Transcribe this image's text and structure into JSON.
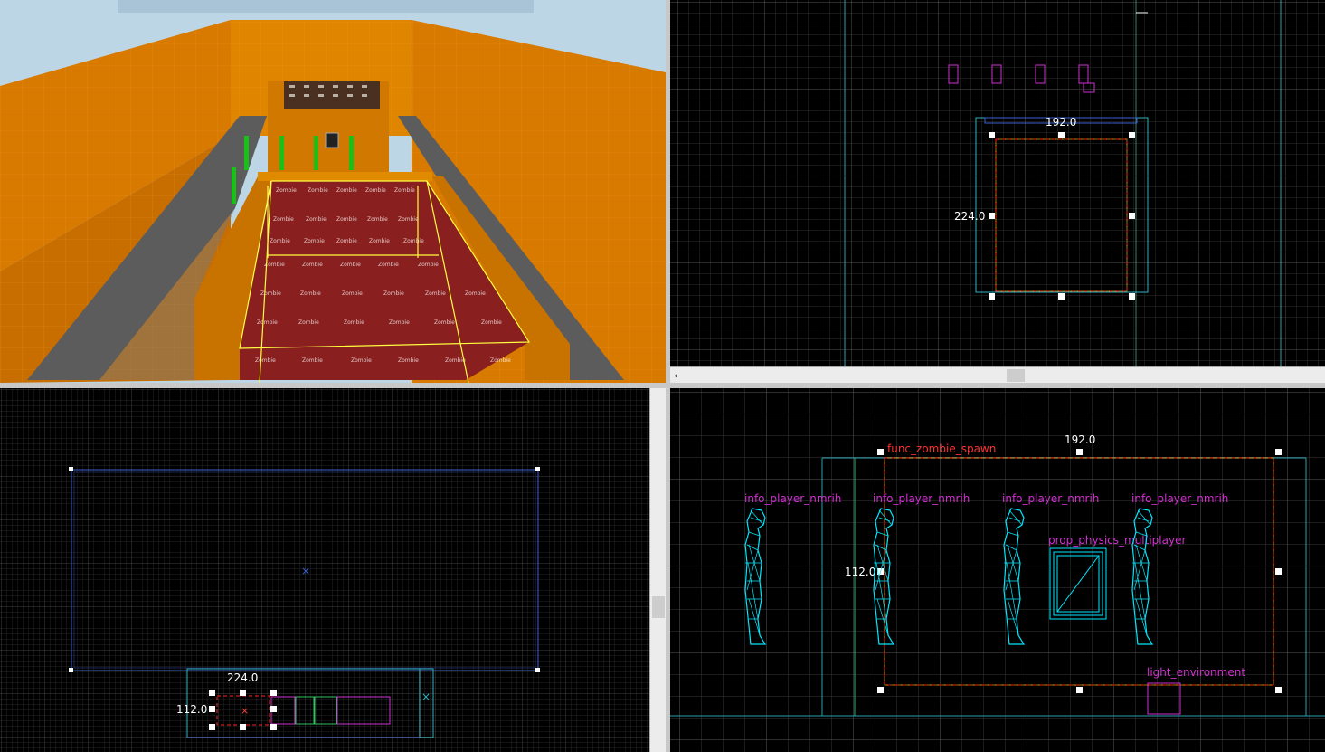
{
  "viewport_3d": {
    "texture_label": "Zombie Spawn"
  },
  "viewport_top": {
    "width_label": "192.0",
    "height_label": "224.0"
  },
  "viewport_front": {
    "width_label": "224.0",
    "height_label": "112.0"
  },
  "viewport_side": {
    "width_label": "192.0",
    "height_label": "112.0",
    "entities": {
      "zombie_spawn": "func_zombie_spawn",
      "player_1": "info_player_nmrih",
      "player_2": "info_player_nmrih",
      "player_3": "info_player_nmrih",
      "player_4": "info_player_nmrih",
      "prop": "prop_physics_multiplayer",
      "light": "light_environment"
    }
  },
  "colors": {
    "grid_minor": "#262626",
    "grid_major": "#4a4a4a",
    "selection": "#ffffff",
    "brush_blue": "#3a5fd0",
    "brush_cyan": "#30b0c0",
    "entity_magenta": "#d030d0",
    "player_cyan": "#00e8ff",
    "zombie_red": "#ff2020",
    "wall_orange": "#d97a00",
    "floor_red": "#7a1c1c"
  }
}
